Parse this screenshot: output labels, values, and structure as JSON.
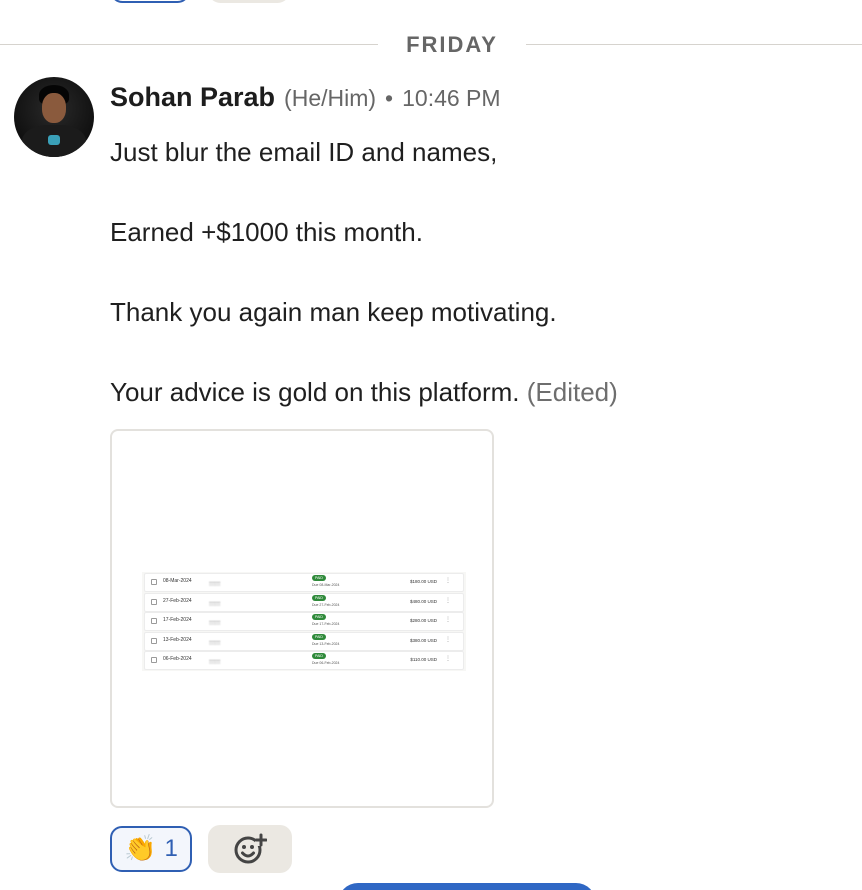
{
  "day_divider": {
    "label": "FRIDAY"
  },
  "message": {
    "sender": "Sohan Parab",
    "pronouns": "(He/Him)",
    "separator": "•",
    "time": "10:46 PM",
    "lines": [
      "Just blur the email ID and names,",
      "Earned +$1000 this month.",
      "Thank you again man keep motivating.",
      "Your advice is gold on this platform."
    ],
    "edited_tag": "(Edited)",
    "attachment": {
      "rows": [
        {
          "date": "08-Mar-2024",
          "status": "PAID",
          "due": "Due 08-Mar-2024",
          "amount": "$180.00 USD"
        },
        {
          "date": "27-Feb-2024",
          "status": "PAID",
          "due": "Due 27-Feb-2024",
          "amount": "$480.00 USD"
        },
        {
          "date": "17-Feb-2024",
          "status": "PAID",
          "due": "Due 17-Feb-2024",
          "amount": "$280.00 USD"
        },
        {
          "date": "13-Feb-2024",
          "status": "PAID",
          "due": "Due 13-Feb-2024",
          "amount": "$380.00 USD"
        },
        {
          "date": "06-Feb-2024",
          "status": "PAID",
          "due": "Due 06-Feb-2024",
          "amount": "$110.00 USD"
        }
      ]
    }
  },
  "reactions": [
    {
      "emoji": "👏",
      "icon": "clapping-hands-icon",
      "count": "1"
    }
  ],
  "add_reaction": {
    "icon": "add-reaction-icon"
  },
  "colors": {
    "accent": "#2f5fb3",
    "pill_bg": "#ebe8e2",
    "badge_green": "#2f8a3a"
  }
}
